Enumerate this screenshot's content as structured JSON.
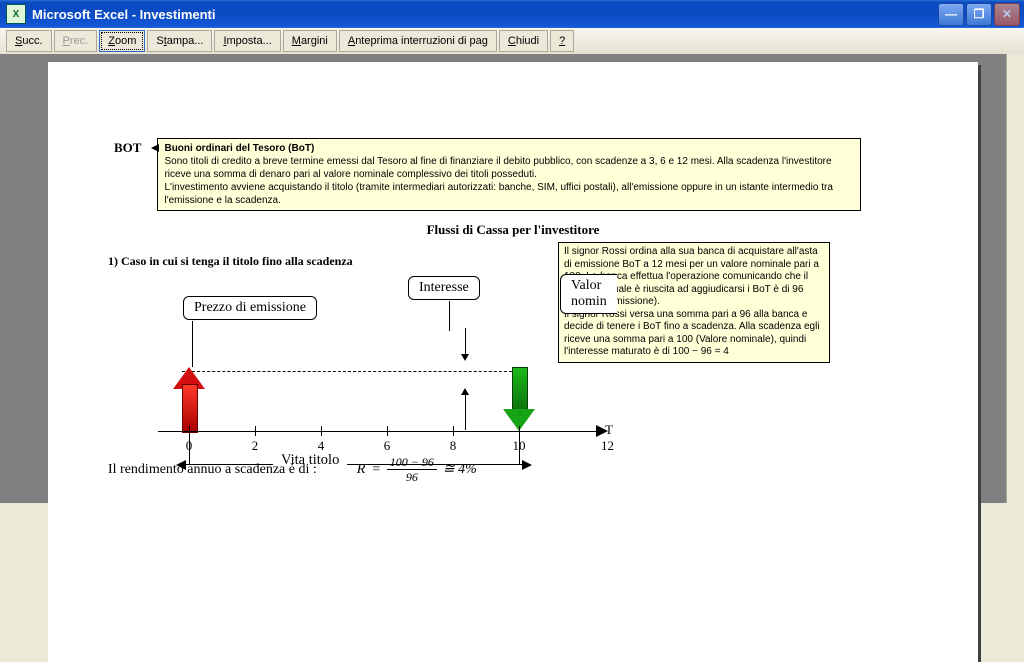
{
  "window": {
    "app_icon_letter": "X",
    "title": "Microsoft Excel - Investimenti"
  },
  "toolbar": {
    "succ": "Succ.",
    "prec": "Prec.",
    "zoom": "Zoom",
    "stampa": "Stampa...",
    "imposta": "Imposta...",
    "margini": "Margini",
    "anteprima": "Anteprima interruzioni di pag",
    "chiudi": "Chiudi",
    "help": "?"
  },
  "content": {
    "bot_label": "BOT",
    "bot_box_title": "Buoni ordinari del Tesoro (BoT)",
    "bot_box_body": "Sono titoli di credito a breve termine emessi dal Tesoro al fine di finanziare il debito pubblico, con scadenze a 3, 6 e 12 mesi. Alla scadenza l'investitore riceve una somma di denaro pari al valore nominale complessivo dei titoli posseduti.\nL'investimento avviene acquistando il titolo (tramite intermediari autorizzati: banche, SIM, uffici postali), all'emissione  oppure in un istante intermedio tra l'emissione e la scadenza.",
    "section_title": "Flussi di Cassa per l'investitore",
    "case_title": "1) Caso in cui si tenga il titolo fino alla scadenza",
    "rossi_box": "Il signor Rossi ordina alla sua banca di acquistare all'asta di emissione BoT a 12 mesi per un valore nominale pari a 100. La banca effettua l'operazione comunicando che il prezzo al quale è riuscita ad aggiudicarsi i BoT è di 96 (Prezzo d'emissione).\nIl signor Rossi versa una somma pari a 96 alla banca e decide di tenere i BoT fino a scadenza. Alla scadenza egli riceve una somma pari a 100 (Valore nominale), quindi l'interesse maturato è di 100 − 96 = 4",
    "callout_prezzo": "Prezzo di emissione",
    "callout_interesse": "Interesse",
    "callout_valore1": "Valor",
    "callout_valore2": "nomin",
    "vita_titolo": "Vita titolo",
    "axis_T": "T",
    "axis_12": "12",
    "rendimento_text": "Il rendimento annuo a scadenza è di :",
    "formula_R": "R",
    "formula_eq": "=",
    "formula_num": "100 − 96",
    "formula_den": "96",
    "formula_approx": "≅ 4%"
  },
  "chart_data": {
    "type": "timeline",
    "title": "Flussi di Cassa per l'investitore",
    "x_axis": {
      "label": "T",
      "values": [
        0,
        2,
        4,
        6,
        8,
        10,
        12
      ]
    },
    "span": {
      "label": "Vita titolo",
      "from": 0,
      "to": 10
    },
    "events": [
      {
        "t": 0,
        "direction": "out",
        "label": "Prezzo di emissione",
        "amount": 96
      },
      {
        "t": 10,
        "direction": "in",
        "label": "Valore nominale",
        "amount": 100
      }
    ],
    "interest": {
      "label": "Interesse",
      "value": 4,
      "computed_as": "100 - 96"
    },
    "yield_formula": "R = (100 - 96) / 96 ≅ 4%"
  }
}
